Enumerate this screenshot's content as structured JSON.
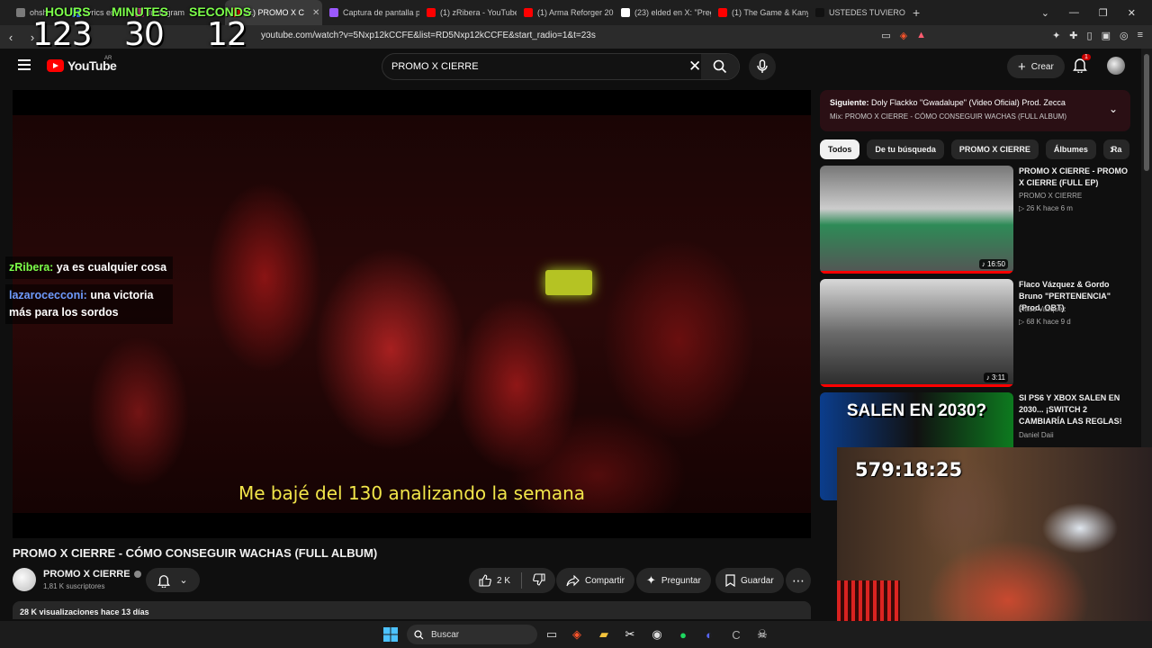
{
  "browser": {
    "tabs": [
      {
        "label": "ohshi",
        "color": "#7a7a7a"
      },
      {
        "label": "lyrics en",
        "color": "#3d7bff"
      },
      {
        "label": "Instagram",
        "color": "#c13584"
      },
      {
        "label": "(1) PROMO X C",
        "color": "#ff0000",
        "active": true
      },
      {
        "label": "Captura de pantalla p",
        "color": "#9b59ff"
      },
      {
        "label": "(1) zRibera - YouTube",
        "color": "#ff0000"
      },
      {
        "label": "(1) Arma Reforger 202",
        "color": "#ff0000"
      },
      {
        "label": "(23) elded en X: \"Preg",
        "color": "#ffffff"
      },
      {
        "label": "(1) The Game & Kanye",
        "color": "#ff0000"
      },
      {
        "label": "USTEDES TUVIERON E",
        "color": "#111111"
      }
    ],
    "url": "youtube.com/watch?v=5Nxp12kCCFE&list=RD5Nxp12kCCFE&start_radio=1&t=23s"
  },
  "timer": {
    "hours_label": "HOURS",
    "minutes_label": "MINUTES",
    "seconds_label": "SECONDS",
    "hours": "123",
    "minutes": "30",
    "seconds": "12"
  },
  "header": {
    "logo": "YouTube",
    "region": "AR",
    "search_value": "PROMO X CIERRE",
    "create_label": "Crear",
    "notif_count": "1"
  },
  "video": {
    "subtitle": "Me bajé del 130 analizando la semana",
    "title": "PROMO X CIERRE - CÓMO CONSEGUIR WACHAS (FULL ALBUM)",
    "channel": "PROMO X CIERRE",
    "subscribers": "1,81 K suscriptores",
    "likes": "2 K",
    "share_label": "Compartir",
    "ask_label": "Preguntar",
    "save_label": "Guardar",
    "views_line": "28 K visualizaciones  hace 13 días"
  },
  "chat": [
    {
      "user": "zRibera:",
      "text": " ya es cualquier cosa",
      "color": "#7CFF4A"
    },
    {
      "user": "lazarocecconi:",
      "text": " una victoria más para los sordos",
      "color": "#6f9cff"
    }
  ],
  "sidebar": {
    "upnext_label": "Siguiente:",
    "upnext_title": " Doly Flackko \"Gwadalupe\" (Video Oficial) Prod. Zecca",
    "upnext_mix": "Mix: PROMO X CIERRE - CÓMO CONSEGUIR WACHAS (FULL ALBUM)",
    "chips": [
      "Todos",
      "De tu búsqueda",
      "PROMO X CIERRE",
      "Álbumes",
      "Ra"
    ],
    "recs": [
      {
        "title": "PROMO X CIERRE - PROMO X CIERRE (FULL EP)",
        "channel": "PROMO X CIERRE",
        "meta": "▷ 26 K  hace 6 m",
        "duration": "♪ 16:50",
        "progress": 1.0
      },
      {
        "title": "Flaco Vázquez & Gordo Bruno \"PERTENENCIA\" (Prod. OBT)",
        "channel": "Flaco Vazquez",
        "meta": "▷ 68 K  hace 9 d",
        "duration": "♪ 3:11",
        "progress": 1.0
      },
      {
        "title": "SI PS6 Y XBOX SALEN EN 2030... ¡SWITCH 2 CAMBIARÍA LAS REGLAS!",
        "channel": "Daniel Daii",
        "meta": "",
        "duration": "",
        "thumb_text": "SALEN EN 2030?",
        "progress": 0
      }
    ]
  },
  "webcam": {
    "timer": "579:18:25"
  },
  "taskbar": {
    "search_label": "Buscar"
  }
}
